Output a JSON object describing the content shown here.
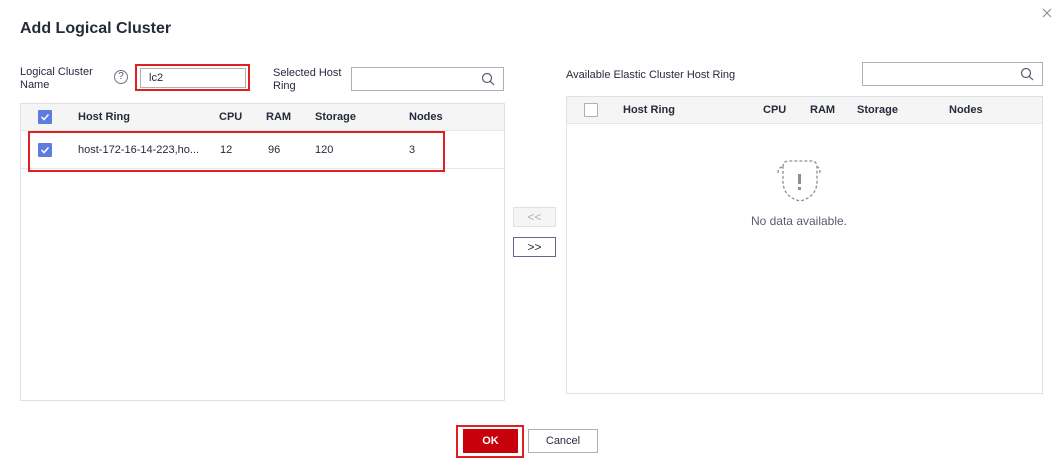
{
  "dialog": {
    "title": "Add Logical Cluster"
  },
  "form": {
    "cluster_name_label": "Logical Cluster Name",
    "cluster_name_value": "lc2",
    "selected_host_ring_label": "Selected Host Ring",
    "selected_search_value": "",
    "available_label": "Available Elastic Cluster Host Ring",
    "available_search_value": ""
  },
  "selected_table": {
    "columns": [
      "Host Ring",
      "CPU",
      "RAM",
      "Storage",
      "Nodes"
    ],
    "header_checked": true,
    "rows": [
      {
        "checked": true,
        "host_ring": "host-172-16-14-223,ho...",
        "cpu": "12",
        "ram": "96",
        "storage": "120",
        "nodes": "3"
      }
    ]
  },
  "available_table": {
    "columns": [
      "Host Ring",
      "CPU",
      "RAM",
      "Storage",
      "Nodes"
    ],
    "header_checked": false,
    "empty_text": "No data available."
  },
  "transfer": {
    "to_left_label": "<<",
    "to_right_label": ">>"
  },
  "footer": {
    "ok_label": "OK",
    "cancel_label": "Cancel"
  },
  "icons": {
    "close": "close-icon",
    "help": "help-icon",
    "search": "search-icon",
    "empty": "empty-data-icon",
    "check": "check-icon"
  },
  "colors": {
    "primary_button": "#c7000b",
    "checkbox_checked": "#5e7ce0",
    "highlight_box": "#e02020",
    "table_header_bg": "#f5f5f6"
  }
}
